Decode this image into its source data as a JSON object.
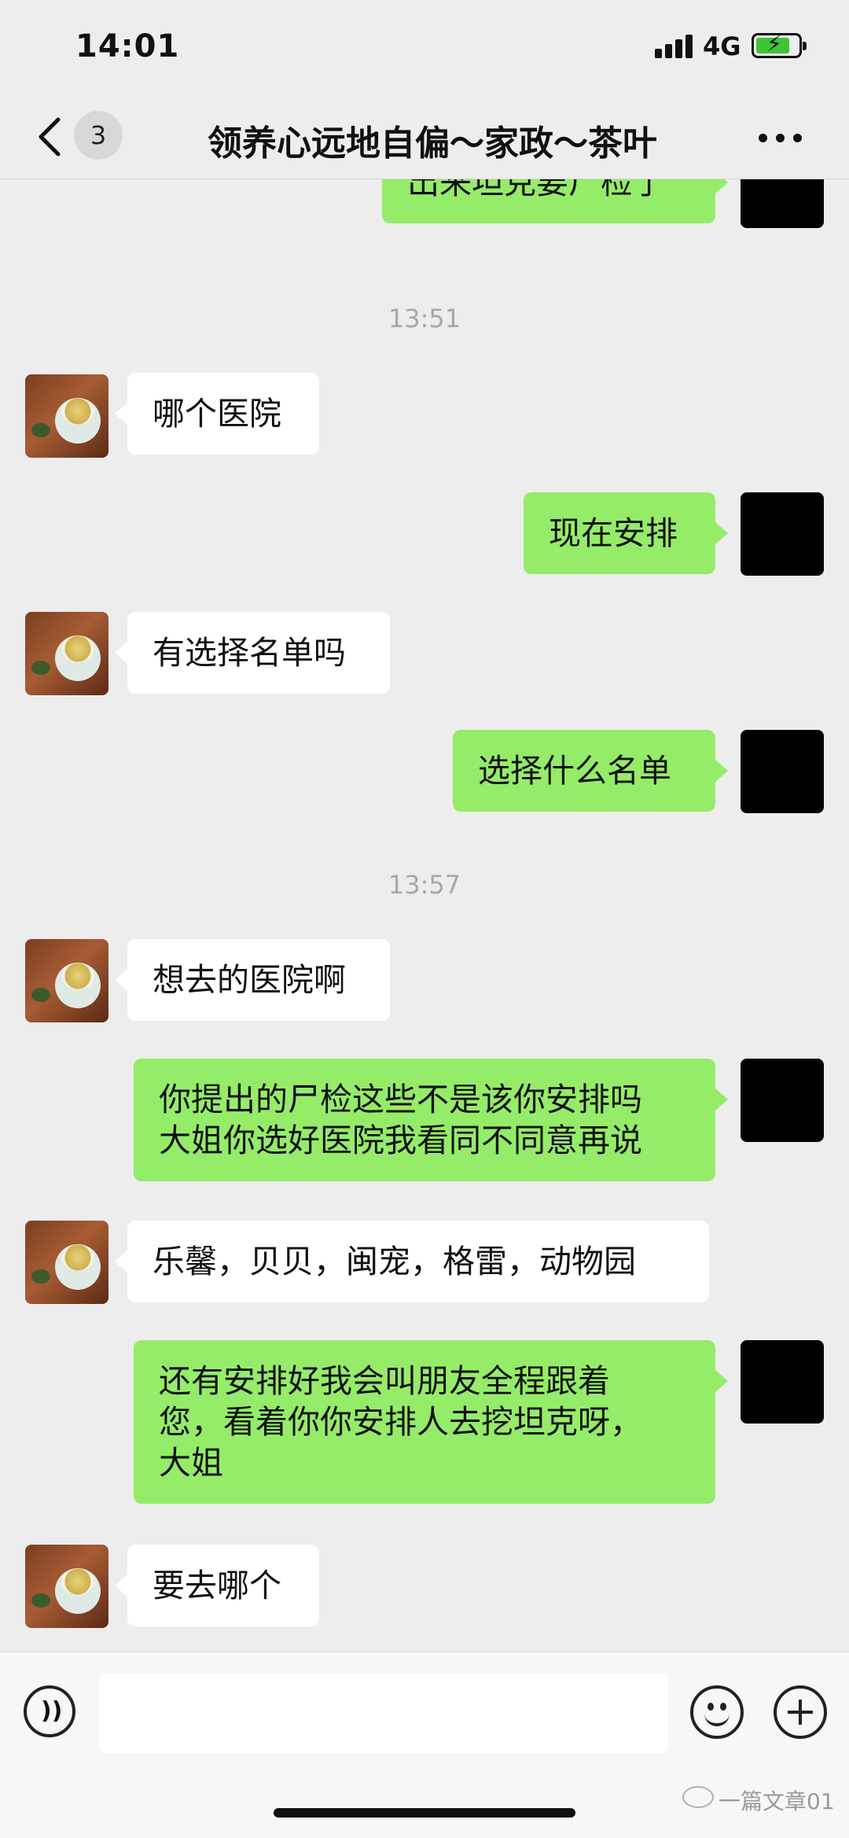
{
  "status_bar": {
    "time": "14:01",
    "network": "4G",
    "battery_icon": "battery-charging-icon"
  },
  "nav": {
    "back_icon": "chevron-left-icon",
    "unread_count": "3",
    "title": "领养心远地自偏～家政～茶叶",
    "more_icon": "more-dots-icon"
  },
  "messages": [
    {
      "side": "right",
      "lines": [
        "出来坦克要尸检了"
      ]
    },
    {
      "type": "time",
      "text": "13:51"
    },
    {
      "side": "left",
      "lines": [
        "哪个医院"
      ]
    },
    {
      "side": "right",
      "lines": [
        "现在安排"
      ]
    },
    {
      "side": "left",
      "lines": [
        "有选择名单吗"
      ]
    },
    {
      "side": "right",
      "lines": [
        "选择什么名单"
      ]
    },
    {
      "type": "time",
      "text": "13:57"
    },
    {
      "side": "left",
      "lines": [
        "想去的医院啊"
      ]
    },
    {
      "side": "right",
      "lines": [
        "你提出的尸检这些不是该你安排吗",
        "大姐你选好医院我看同不同意再说"
      ]
    },
    {
      "side": "left",
      "lines": [
        "乐馨，贝贝，闽宠，格雷，动物园"
      ]
    },
    {
      "side": "right",
      "lines": [
        "还有安排好我会叫朋友全程跟着",
        "您，看着你你安排人去挖坦克呀，",
        "大姐"
      ]
    },
    {
      "side": "left",
      "lines": [
        "要去哪个"
      ]
    }
  ],
  "input_bar": {
    "voice_icon": "voice-icon",
    "emoji_icon": "emoji-icon",
    "plus_icon": "plus-icon",
    "input_value": ""
  },
  "watermark": "一篇文章01",
  "colors": {
    "background": "#ededed",
    "sent_bubble": "#95ec69",
    "received_bubble": "#ffffff"
  }
}
